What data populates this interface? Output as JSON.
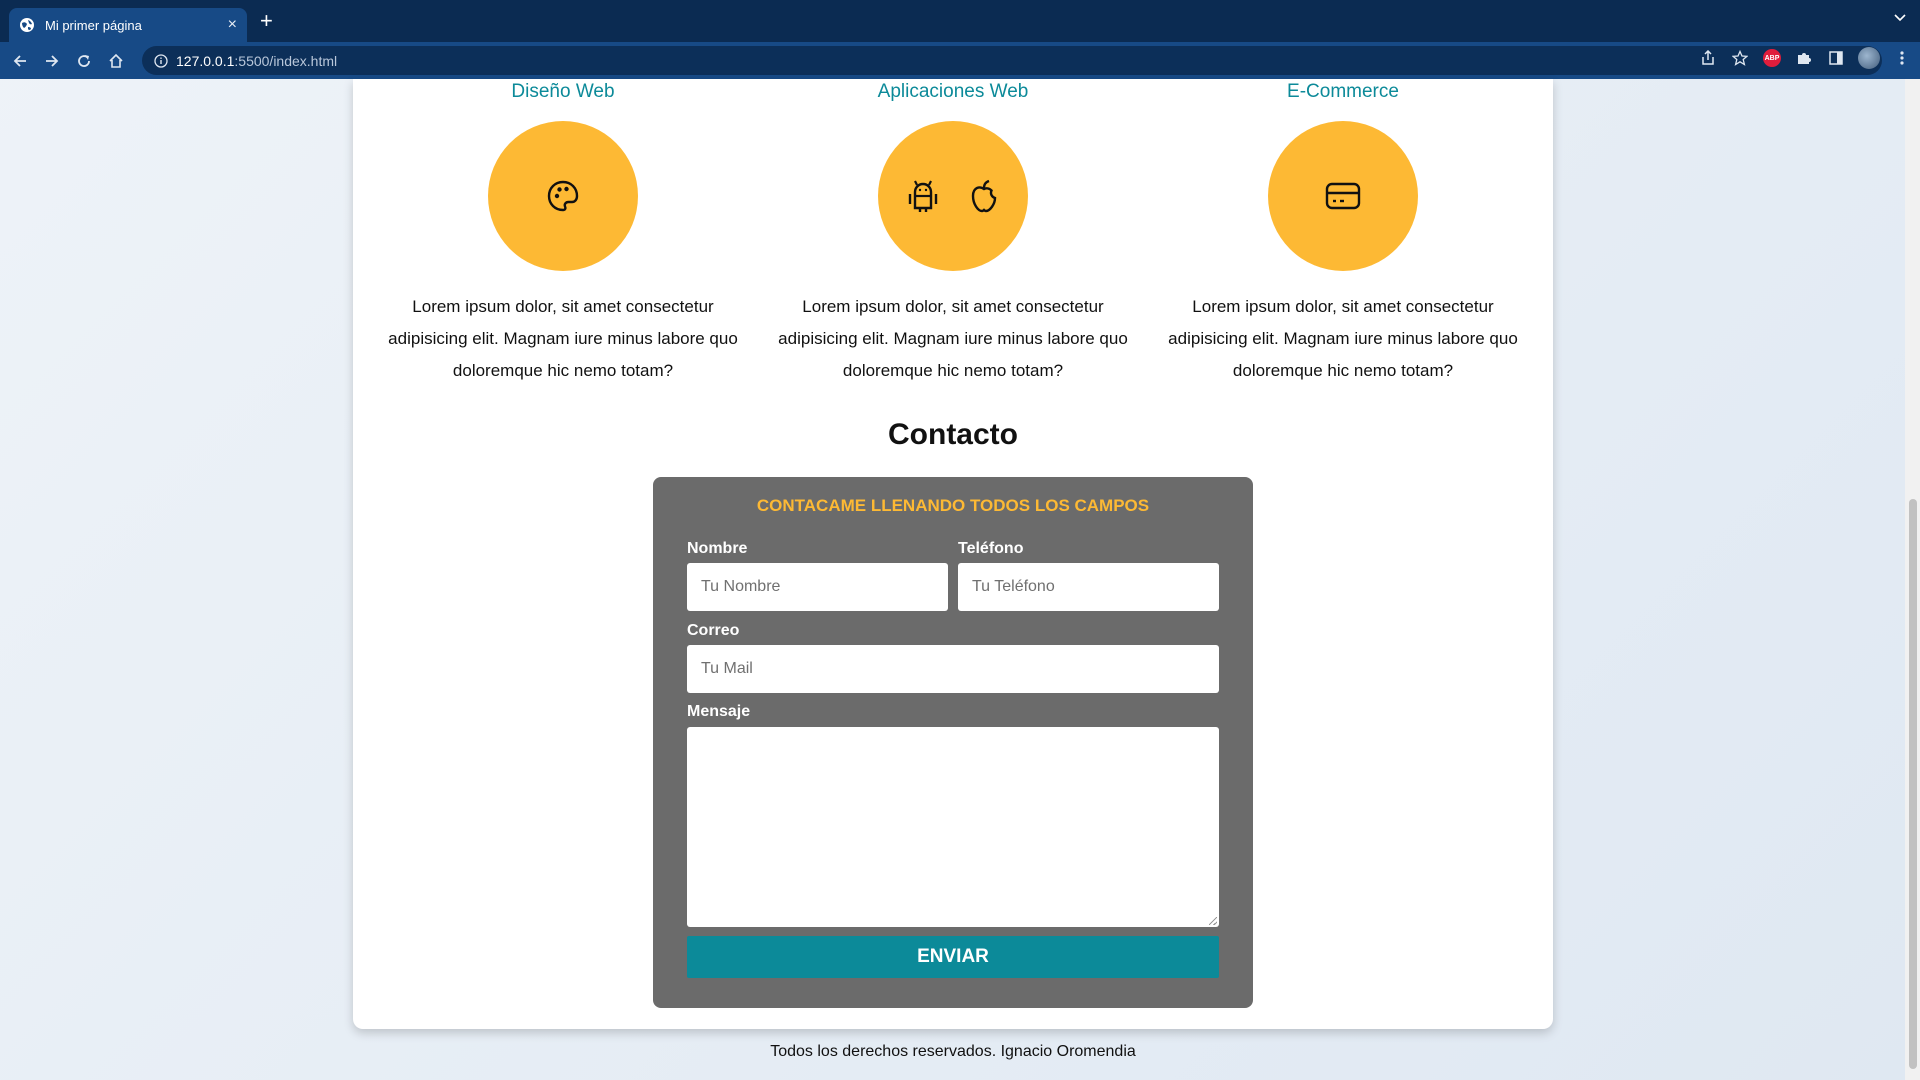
{
  "browser": {
    "tab_title": "Mi primer página",
    "url_host": "127.0.0.1",
    "url_rest": ":5500/index.html",
    "new_tab_label": "+",
    "close_label": "×",
    "abp_label": "ABP"
  },
  "services": [
    {
      "title": "Diseño Web",
      "icons": [
        "palette-icon"
      ],
      "text": "Lorem ipsum dolor, sit amet consectetur adipisicing elit. Magnam iure minus labore quo doloremque hic nemo totam?"
    },
    {
      "title": "Aplicaciones Web",
      "icons": [
        "android-icon",
        "apple-icon"
      ],
      "text": "Lorem ipsum dolor, sit amet consectetur adipisicing elit. Magnam iure minus labore quo doloremque hic nemo totam?"
    },
    {
      "title": "E-Commerce",
      "icons": [
        "credit-card-icon"
      ],
      "text": "Lorem ipsum dolor, sit amet consectetur adipisicing elit. Magnam iure minus labore quo doloremque hic nemo totam?"
    }
  ],
  "contact": {
    "title": "Contacto",
    "form_heading": "CONTACAME LLENANDO TODOS LOS CAMPOS",
    "fields": {
      "name": {
        "label": "Nombre",
        "placeholder": "Tu Nombre",
        "value": ""
      },
      "phone": {
        "label": "Teléfono",
        "placeholder": "Tu Teléfono",
        "value": ""
      },
      "email": {
        "label": "Correo",
        "placeholder": "Tu Mail",
        "value": ""
      },
      "message": {
        "label": "Mensaje",
        "placeholder": "",
        "value": ""
      }
    },
    "submit_label": "ENVIAR"
  },
  "footer": {
    "text": "Todos los derechos reservados. Ignacio Oromendia"
  },
  "colors": {
    "accent_teal": "#0c8a99",
    "accent_yellow": "#fdb934",
    "form_bg": "#6b6b6b",
    "browser_chrome": "#174a86"
  }
}
